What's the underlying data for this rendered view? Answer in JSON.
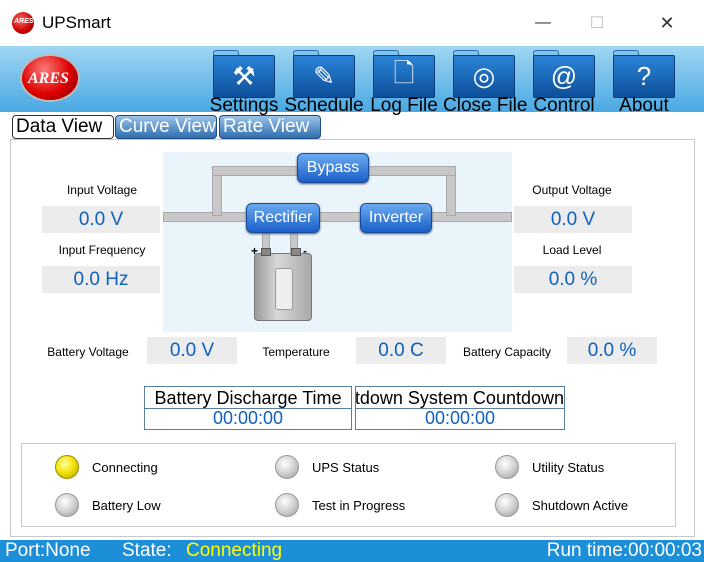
{
  "window": {
    "title": "UPSmart",
    "minimize": "—",
    "maximize": "☐",
    "close": "✕"
  },
  "app_icon_text": "ARES",
  "logo_text": "ARES",
  "toolbar": [
    {
      "label": "Settings",
      "icon": "hammer-icon",
      "glyph": "⚒"
    },
    {
      "label": "Schedule",
      "icon": "pencil-icon",
      "glyph": "✎"
    },
    {
      "label": "Log File",
      "icon": "document-icon",
      "glyph": "🗋"
    },
    {
      "label": "Close File",
      "icon": "circle-icon",
      "glyph": "◎"
    },
    {
      "label": "Control",
      "icon": "at-icon",
      "glyph": "@"
    },
    {
      "label": "About",
      "icon": "question-icon",
      "glyph": "?"
    }
  ],
  "tabs": [
    "Data View",
    "Curve View",
    "Rate View"
  ],
  "diagram": {
    "bypass": "Bypass",
    "rectifier": "Rectifier",
    "inverter": "Inverter",
    "plus": "+",
    "minus": "-"
  },
  "input": {
    "voltage_label": "Input Voltage",
    "voltage": "0.0 V",
    "frequency_label": "Input Frequency",
    "frequency": "0.0 Hz"
  },
  "output": {
    "voltage_label": "Output Voltage",
    "voltage": "0.0 V",
    "load_label": "Load Level",
    "load": "0.0 %"
  },
  "battery": {
    "voltage_label": "Battery Voltage",
    "voltage": "0.0 V",
    "temp_label": "Temperature",
    "temp": "0.0 C",
    "capacity_label": "Battery Capacity",
    "capacity": "0.0 %"
  },
  "timers": {
    "discharge_label": "Battery Discharge Time",
    "discharge": "00:00:00",
    "shutdown_label": "Shutdown System Countdown",
    "shutdown": "00:00:00"
  },
  "indicators": [
    {
      "label": "Connecting",
      "on": true
    },
    {
      "label": "UPS Status",
      "on": false
    },
    {
      "label": "Utility Status",
      "on": false
    },
    {
      "label": "Battery Low",
      "on": false
    },
    {
      "label": "Test in Progress",
      "on": false
    },
    {
      "label": "Shutdown Active",
      "on": false
    }
  ],
  "statusbar": {
    "port": "Port:None",
    "state_label": "State:",
    "state": "Connecting",
    "runtime": "Run time:00:00:03"
  },
  "colors": {
    "accent": "#1d8fd8",
    "state_value": "#ffff00",
    "led_on": "#f0e000",
    "value_text": "#1060c0"
  }
}
